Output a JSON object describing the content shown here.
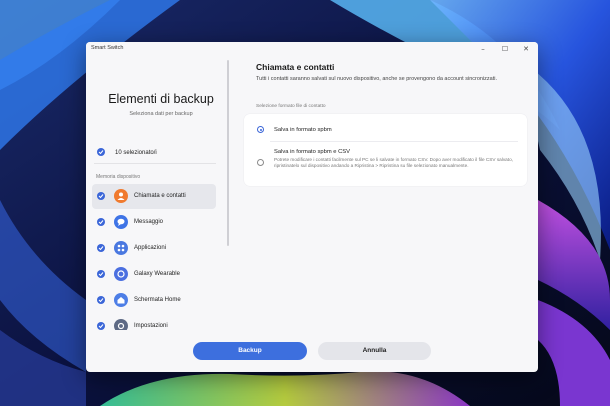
{
  "window": {
    "title": "Smart Switch"
  },
  "window_controls": {
    "minimize": "–",
    "maximize": "☐",
    "close": "✕"
  },
  "left": {
    "heading": "Elementi di backup",
    "subheading": "Seleziona dati per backup",
    "selected_count": "10 selezionato/i",
    "section_label": "Memoria dispositivo",
    "categories": [
      {
        "label": "Chiamata e contatti",
        "icon": "contacts-icon",
        "color": "#f07a2e",
        "selected": true
      },
      {
        "label": "Messaggio",
        "icon": "message-icon",
        "color": "#3f74e6",
        "selected": false
      },
      {
        "label": "Applicazioni",
        "icon": "apps-icon",
        "color": "#4a78e0",
        "selected": false
      },
      {
        "label": "Galaxy Wearable",
        "icon": "wearable-icon",
        "color": "#4b6fe0",
        "selected": false
      },
      {
        "label": "Schermata Home",
        "icon": "home-icon",
        "color": "#4d7ee6",
        "selected": false
      },
      {
        "label": "Impostazioni",
        "icon": "settings-icon",
        "color": "#5e6a85",
        "selected": false
      }
    ]
  },
  "right": {
    "title": "Chiamata e contatti",
    "description": "Tutti i contatti saranno salvati sul nuovo dispositivo, anche se provengono da account sincronizzati.",
    "format_label": "Selezione formato file di contatto",
    "options": [
      {
        "label": "Salva in formato spbm",
        "selected": true
      },
      {
        "label": "Salva in formato spbm e CSV",
        "selected": false,
        "description": "Potrete modificare i contatti facilmente sul PC se li salvate in formato CSV. Dopo aver modificato il file CSV salvato, ripristinatelo sul dispositivo andando a Ripristina > Ripristina su file selezionato manualmente."
      }
    ]
  },
  "buttons": {
    "backup": "Backup",
    "cancel": "Annulla"
  },
  "colors": {
    "accent": "#3d6fde",
    "check": "#3b66d8",
    "cancel_bg": "#e4e5ea"
  }
}
